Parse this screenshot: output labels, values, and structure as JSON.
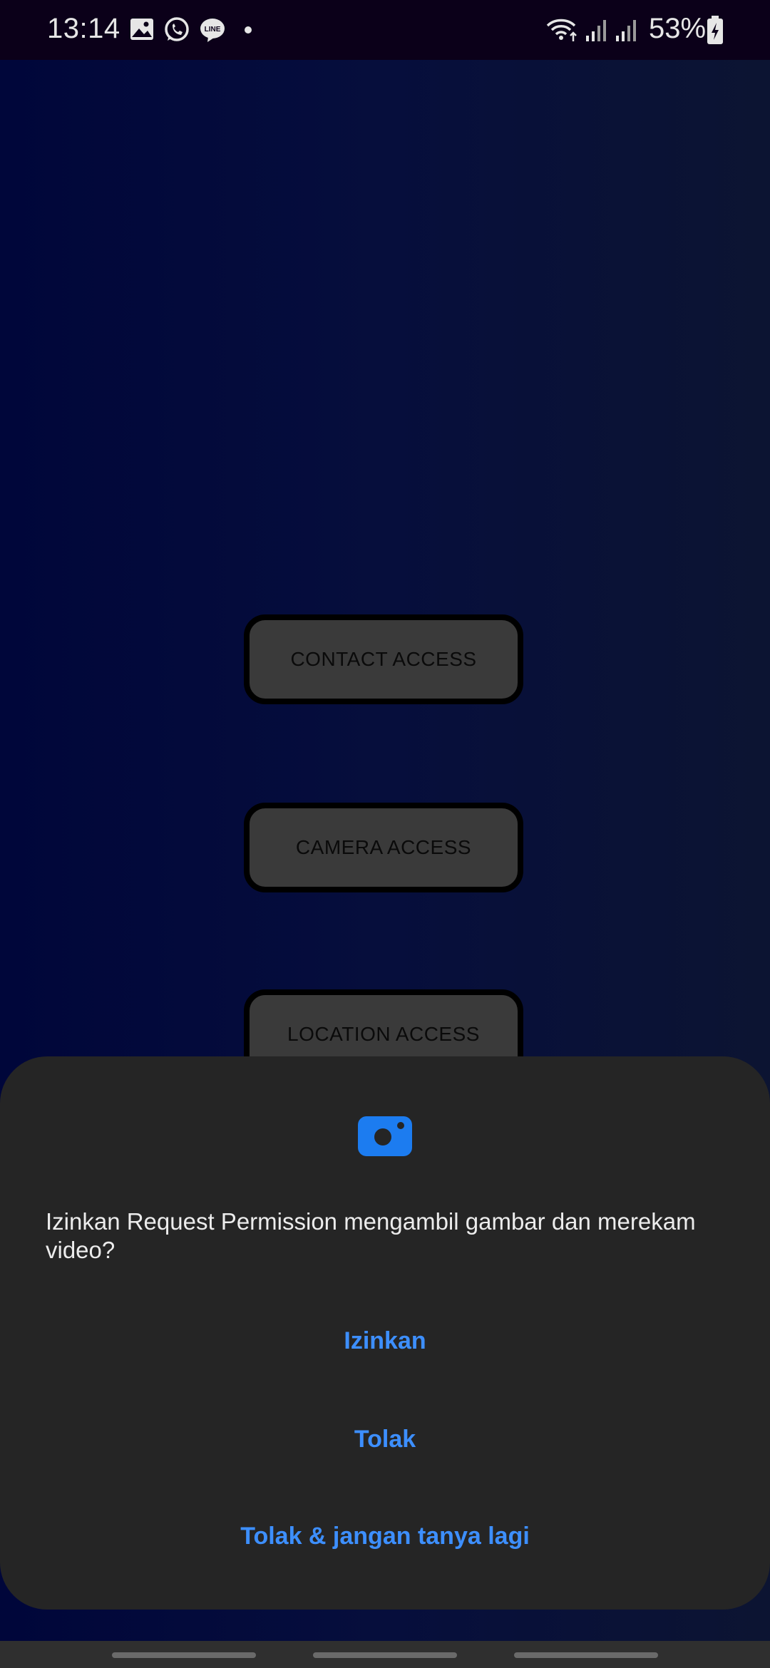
{
  "status_bar": {
    "time": "13:14",
    "notification_icons": [
      "gallery-icon",
      "whatsapp-icon",
      "line-icon",
      "dot-icon"
    ],
    "system_icons": [
      "wifi-icon",
      "signal-icon",
      "signal-icon"
    ],
    "battery": "53%"
  },
  "buttons": {
    "contact": "CONTACT ACCESS",
    "camera": "CAMERA ACCESS",
    "location": "LOCATION ACCESS"
  },
  "dialog": {
    "icon": "camera-icon",
    "message": "Izinkan Request Permission mengambil gambar dan merekam video?",
    "allow": "Izinkan",
    "deny": "Tolak",
    "deny_dont_ask": "Tolak & jangan tanya lagi"
  },
  "colors": {
    "accent": "#3d8fff",
    "dialog_bg": "#252525",
    "button_bg": "#3a3a3a",
    "background": "#00063a"
  }
}
